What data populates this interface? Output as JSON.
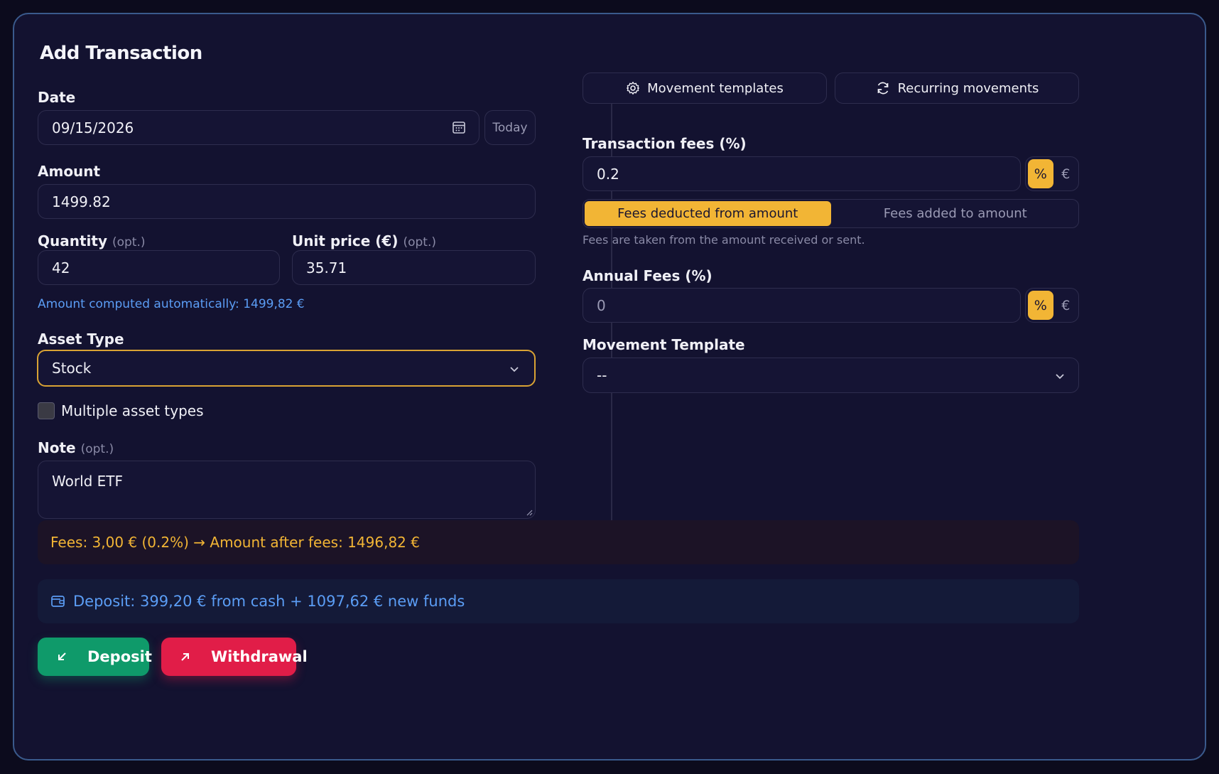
{
  "form": {
    "title": "Add Transaction",
    "date_label": "Date",
    "date_value": "09/15/2026",
    "today_label": "Today",
    "amount_label": "Amount",
    "amount_value": "1499.82",
    "quantity_label": "Quantity",
    "quantity_opt": "(opt.)",
    "quantity_value": "42",
    "unit_price_label": "Unit price (€)",
    "unit_price_opt": "(opt.)",
    "unit_price_value": "35.71",
    "computed_note": "Amount computed automatically: 1499,82 €",
    "asset_type_label": "Asset Type",
    "asset_type_value": "Stock",
    "multiple_label": "Multiple asset types",
    "note_label": "Note",
    "note_opt": "(opt.)",
    "note_value": "World ETF"
  },
  "right": {
    "templates_btn": "Movement templates",
    "recurring_btn": "Recurring movements",
    "tx_fees_label": "Transaction fees (%)",
    "tx_fees_value": "0.2",
    "unit_percent": "%",
    "unit_euro": "€",
    "fees_deducted": "Fees deducted from amount",
    "fees_added": "Fees added to amount",
    "fees_explain": "Fees are taken from the amount received or sent.",
    "annual_label": "Annual Fees (%)",
    "annual_value": "0",
    "template_label": "Movement Template",
    "template_value": "--"
  },
  "summary": {
    "fees_line": "Fees: 3,00 € (0.2%) → Amount after fees: 1496,82 €",
    "deposit_line": "Deposit: 399,20 € from cash + 1097,62 € new funds"
  },
  "actions": {
    "deposit": "Deposit",
    "withdraw": "Withdrawal"
  },
  "colors": {
    "accent": "#f2b535",
    "info": "#5b9df5",
    "deposit": "#0f9a6a",
    "withdraw": "#e11d48"
  }
}
